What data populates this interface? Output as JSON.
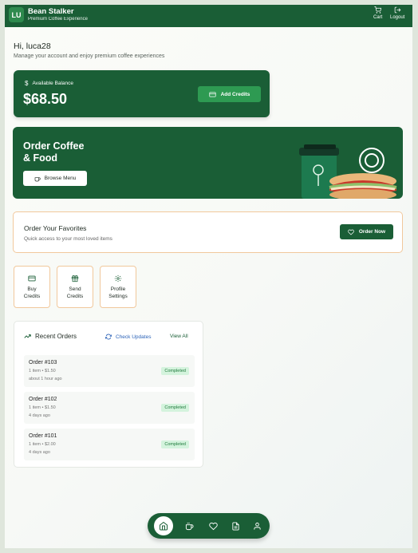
{
  "header": {
    "logo_text": "LU",
    "brand_title": "Bean Stalker",
    "brand_subtitle": "Premium Coffee Experience",
    "cart_label": "Cart",
    "logout_label": "Logout"
  },
  "greeting": {
    "title": "Hi, luca28",
    "subtitle": "Manage your account and enjoy premium coffee experiences"
  },
  "balance": {
    "label": "Available Balance",
    "amount": "$68.50",
    "add_label": "Add Credits"
  },
  "hero": {
    "title_line1": "Order Coffee",
    "title_line2": "& Food",
    "browse_label": "Browse Menu"
  },
  "favorites": {
    "title": "Order Your Favorites",
    "subtitle": "Quick access to your most loved items",
    "button_label": "Order Now"
  },
  "quick_actions": [
    {
      "line1": "Buy",
      "line2": "Credits",
      "icon": "credit-card-icon"
    },
    {
      "line1": "Send",
      "line2": "Credits",
      "icon": "gift-icon"
    },
    {
      "line1": "Profile",
      "line2": "Settings",
      "icon": "gear-icon"
    }
  ],
  "recent_orders": {
    "title": "Recent Orders",
    "check_label": "Check Updates",
    "view_all_label": "View All",
    "orders": [
      {
        "id": "Order #103",
        "meta": "1 item • $1.50",
        "time": "about 1 hour ago",
        "status": "Completed"
      },
      {
        "id": "Order #102",
        "meta": "1 item • $1.50",
        "time": "4 days ago",
        "status": "Completed"
      },
      {
        "id": "Order #101",
        "meta": "1 item • $2.00",
        "time": "4 days ago",
        "status": "Completed"
      }
    ]
  },
  "bottom_nav": {
    "items": [
      "home-icon",
      "coffee-icon",
      "heart-icon",
      "receipt-icon",
      "user-icon"
    ]
  },
  "colors": {
    "primary": "#1a5e36",
    "accent": "#2e9a52",
    "border_orange": "#f1c89c",
    "link_blue": "#2c63b8"
  }
}
